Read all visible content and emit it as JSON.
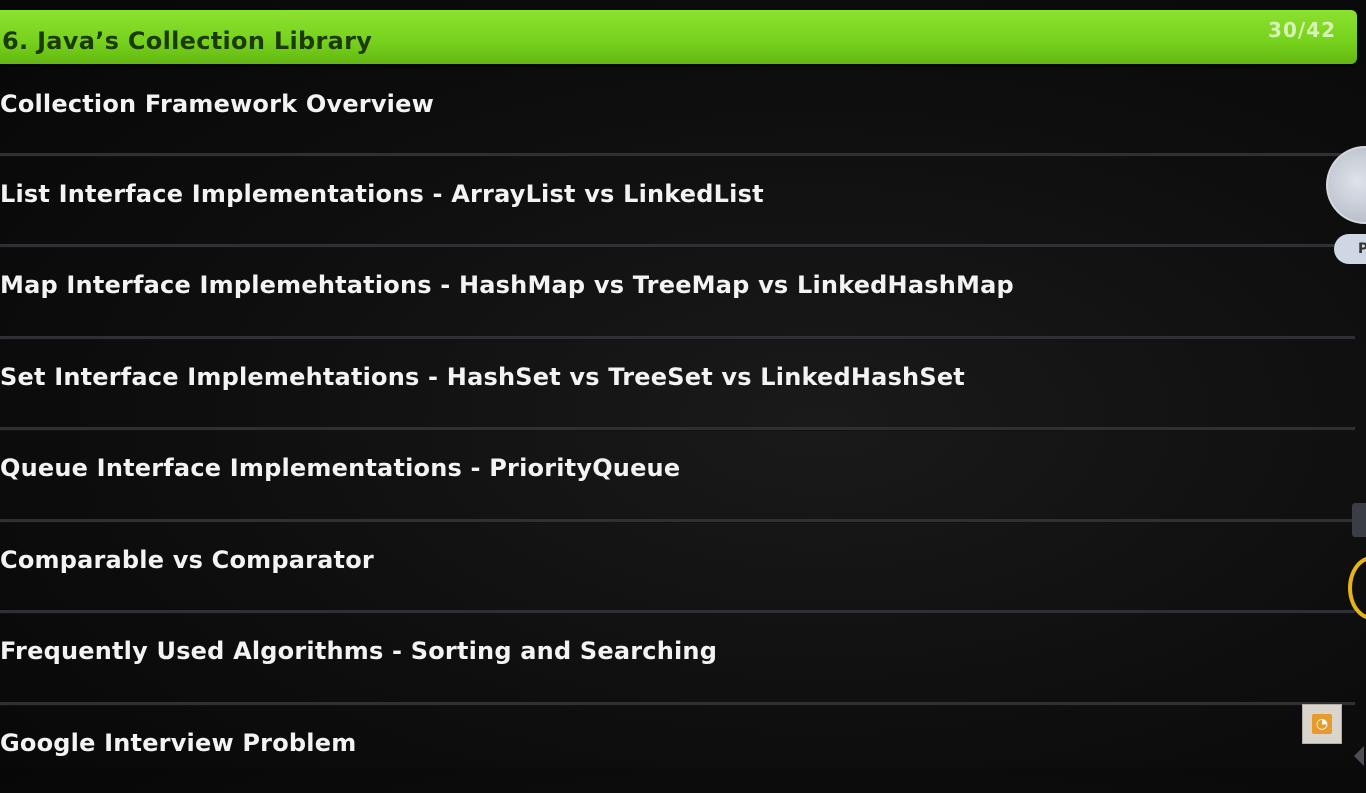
{
  "header": {
    "title": "6. Java’s Collection Library",
    "slide_counter": "30/42"
  },
  "topics": [
    "Collection Framework Overview",
    "List Interface Implementations - ArrayList vs LinkedList",
    "Map Interface Implemehtations - HashMap vs TreeMap vs LinkedHashMap",
    "Set Interface Implemehtations - HashSet vs TreeSet vs LinkedHashSet",
    "Queue Interface Implementations - PriorityQueue",
    "Comparable vs Comparator",
    "Frequently Used Algorithms - Sorting and Searching",
    "Google Interview Problem"
  ],
  "side_overlay": {
    "pill_label": "P"
  },
  "icons": {
    "corner_icon": "app-logo-icon",
    "avatar": "avatar"
  },
  "colors": {
    "header_green": "#76d11c",
    "background": "#0e0e0e",
    "text": "#f3f3f3",
    "ring_yellow": "#e7b415"
  }
}
